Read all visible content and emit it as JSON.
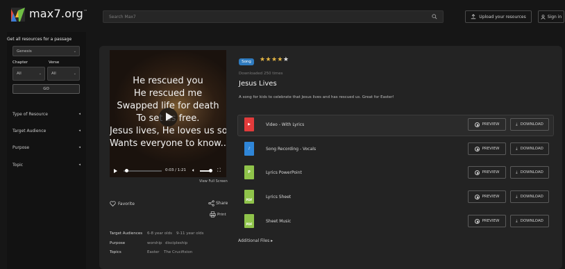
{
  "brand": {
    "name": "max7.org",
    "tm": "™"
  },
  "header": {
    "search_placeholder": "Search Max7",
    "upload_label": "Upload your resources",
    "signin_label": "Sign in"
  },
  "sidebar": {
    "title": "Get all resources for a passage",
    "book_value": "Genesis",
    "chapter_label": "Chapter",
    "verse_label": "Verse",
    "chapter_value": "All",
    "verse_value": "All",
    "go_label": "GO",
    "items": [
      {
        "label": "Type of Resource"
      },
      {
        "label": "Target Audience"
      },
      {
        "label": "Purpose"
      },
      {
        "label": "Topic"
      }
    ]
  },
  "video": {
    "lines": [
      "He rescued you",
      "He rescued me",
      "Swapped life for death",
      "To set us free.",
      "Jesus lives, He loves us so",
      "Wants everyone to know..."
    ],
    "time": "0:03 / 1:21",
    "progress": 0.04,
    "volume": 1.0,
    "view_full": "View Full Screen"
  },
  "actions": {
    "favorite": "Favorite",
    "share": "Share",
    "print": "Print"
  },
  "meta": [
    {
      "label": "Target Audiences",
      "values": [
        "6-8 year olds",
        "9-11 year olds"
      ]
    },
    {
      "label": "Purpose",
      "values": [
        "worship",
        "discipleship"
      ]
    },
    {
      "label": "Topics",
      "values": [
        "Easter",
        "The Crucifixion"
      ]
    }
  ],
  "details": {
    "badge": "Song",
    "rating": 4,
    "rating_max": 5,
    "downloads": "Downloaded 250 times",
    "title": "Jesus Lives",
    "description": "A song for kids to celebrate that Jesus lives and has rescued us. Great for Easter!"
  },
  "resources": [
    {
      "name": "Video - With Lyrics",
      "icon": "video-icon",
      "color": "#e23b3b",
      "glyph": "▶"
    },
    {
      "name": "Song Recording - Vocals",
      "icon": "audio-icon",
      "color": "#2f86d8",
      "glyph": "♪"
    },
    {
      "name": "Lyrics PowerPoint",
      "icon": "powerpoint-icon",
      "color": "#8fc34a",
      "glyph": "P"
    },
    {
      "name": "Lyrics Sheet",
      "icon": "pdf-icon",
      "color": "#8fc34a",
      "glyph": "PDF"
    },
    {
      "name": "Sheet Music",
      "icon": "pdf-icon",
      "color": "#8fc34a",
      "glyph": "PDF"
    }
  ],
  "resource_buttons": {
    "preview": "PREVIEW",
    "download": "DOWNLOAD"
  },
  "additional_files": "Additional Files",
  "colors": {
    "accent_blue": "#2f7bbf",
    "star": "#e8b844",
    "page_bg": "#161616",
    "card_bg": "#232323"
  }
}
